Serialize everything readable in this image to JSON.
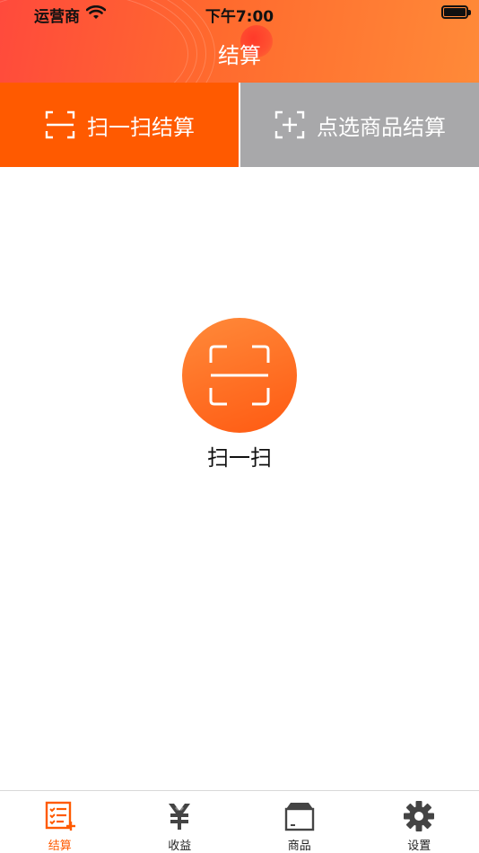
{
  "status_bar": {
    "carrier": "运营商",
    "time": "下午7:00",
    "battery_level": 1.0
  },
  "nav": {
    "title": "结算"
  },
  "mode_tabs": [
    {
      "label": "扫一扫结算",
      "icon": "scan-frame-icon",
      "active": true
    },
    {
      "label": "点选商品结算",
      "icon": "add-frame-icon",
      "active": false
    }
  ],
  "scan": {
    "label": "扫一扫",
    "icon": "scan-frame-icon"
  },
  "tabbar": {
    "items": [
      {
        "label": "结算",
        "icon": "checklist-icon",
        "active": true
      },
      {
        "label": "收益",
        "icon": "yuan-icon",
        "active": false
      },
      {
        "label": "商品",
        "icon": "box-icon",
        "active": false
      },
      {
        "label": "设置",
        "icon": "gear-icon",
        "active": false
      }
    ]
  },
  "colors": {
    "accent": "#ff5a00",
    "inactive_tab": "#a8a8aa",
    "header_start": "#ff4a3c",
    "header_end": "#ff8a38"
  }
}
